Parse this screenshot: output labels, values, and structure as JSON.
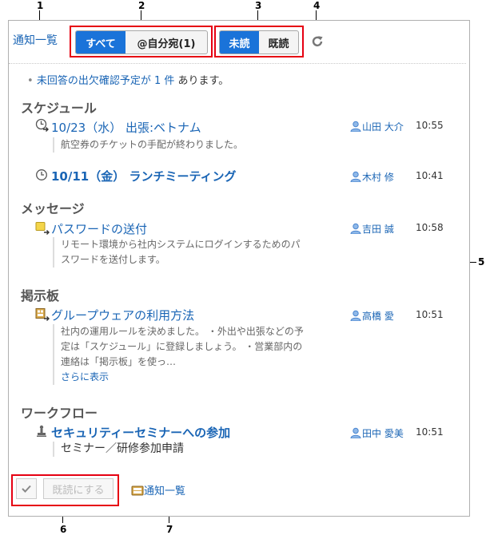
{
  "callouts": [
    "1",
    "2",
    "3",
    "4",
    "5",
    "6",
    "7"
  ],
  "header": {
    "title": "通知一覧",
    "filter_all": "すべて",
    "filter_mine": "@自分宛(1)",
    "filter_unread": "未読",
    "filter_read": "既読"
  },
  "notice": {
    "prefix": "未回答の出欠確認予定が",
    "count": "1 件",
    "suffix": "あります。"
  },
  "sections": {
    "schedule": {
      "title": "スケジュール",
      "items": [
        {
          "title": "10/23（水） 出張:ベトナム",
          "user": "山田 大介",
          "time": "10:55",
          "body": "航空券のチケットの手配が終わりました。"
        },
        {
          "title": "10/11（金） ランチミーティング",
          "user": "木村 修",
          "time": "10:41"
        }
      ]
    },
    "message": {
      "title": "メッセージ",
      "items": [
        {
          "title": "パスワードの送付",
          "user": "吉田 誠",
          "time": "10:58",
          "body1": "リモート環境から社内システムにログインするためのパ",
          "body2": "スワードを送付します。"
        }
      ]
    },
    "bulletin": {
      "title": "掲示板",
      "items": [
        {
          "title": "グループウェアの利用方法",
          "user": "高橋 愛",
          "time": "10:51",
          "body1": "社内の運用ルールを決めました。 ・外出や出張などの予",
          "body2": "定は「スケジュール」に登録しましょう。 ・営業部内の",
          "body3": "連絡は「掲示板」を使っ…",
          "more": "さらに表示"
        }
      ]
    },
    "workflow": {
      "title": "ワークフロー",
      "items": [
        {
          "title": "セキュリティーセミナーへの参加",
          "user": "田中 愛美",
          "time": "10:51",
          "body": "セミナー／研修参加申請"
        }
      ]
    }
  },
  "footer": {
    "mark_read": "既読にする",
    "list_link": "通知一覧"
  },
  "colors": {
    "accent": "#1a73d9",
    "link": "#1a65b5",
    "callout_box": "#e60012"
  }
}
